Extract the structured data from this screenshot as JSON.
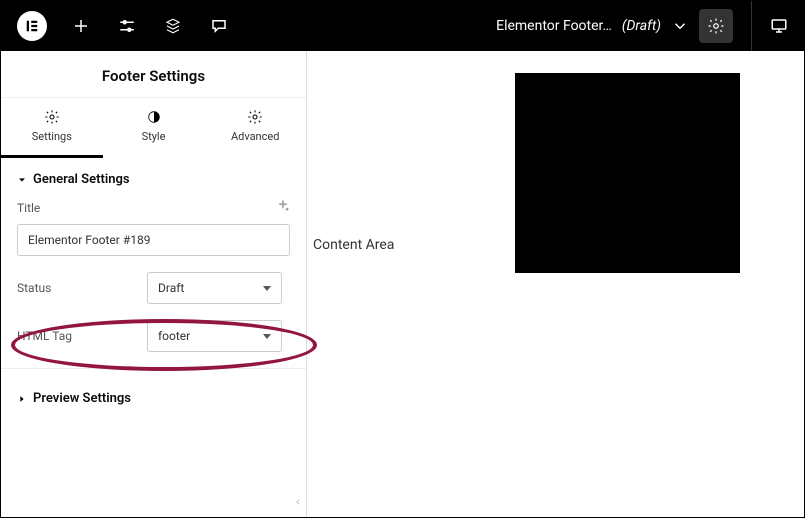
{
  "topbar": {
    "title": "Elementor Footer…",
    "status": "(Draft)"
  },
  "sidebar": {
    "heading": "Footer Settings",
    "tabs": {
      "settings": "Settings",
      "style": "Style",
      "advanced": "Advanced"
    },
    "general_section": "General Settings",
    "title_label": "Title",
    "title_value": "Elementor Footer #189",
    "status_label": "Status",
    "status_value": "Draft",
    "htmltag_label": "HTML Tag",
    "htmltag_value": "footer",
    "preview_section": "Preview Settings"
  },
  "main": {
    "content_label": "Content Area"
  }
}
